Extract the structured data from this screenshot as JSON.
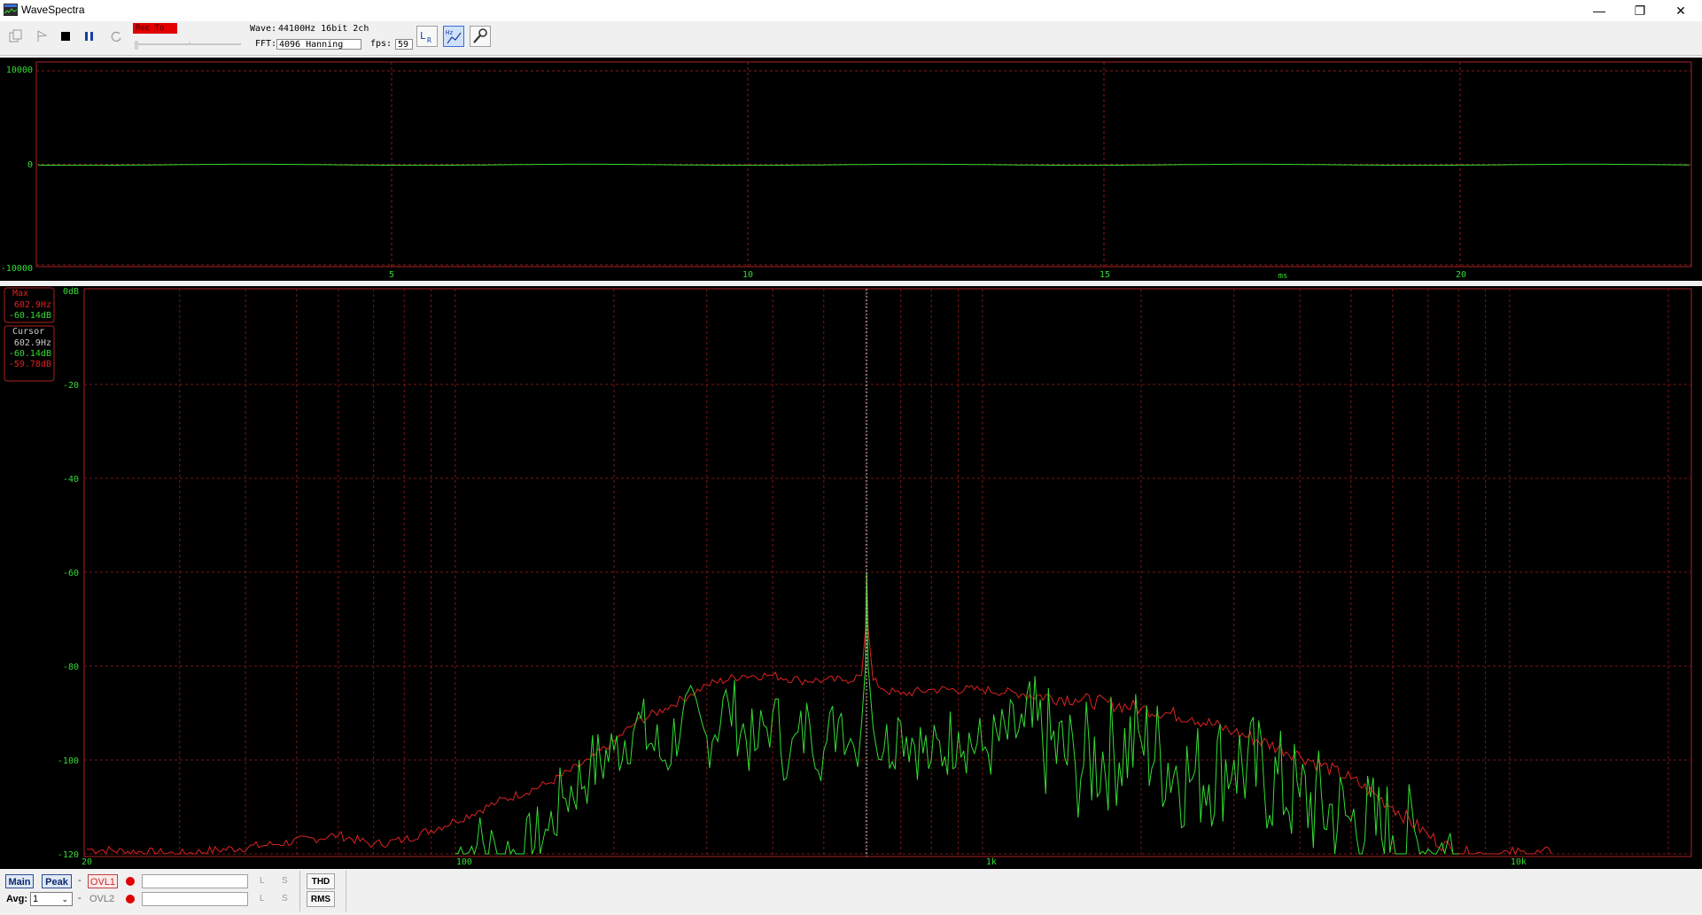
{
  "window": {
    "title": "WaveSpectra",
    "minimize_glyph": "—",
    "restore_glyph": "❐",
    "close_glyph": "✕"
  },
  "toolbar": {
    "rec_label": "Rec To",
    "wave_label": "Wave:",
    "wave_value": "44100Hz 16bit 2ch",
    "fft_label": "FFT:",
    "fft_value": "4096 Hanning",
    "fps_label": "fps:",
    "fps_value": "59",
    "icons": [
      "copy-icon",
      "play-icon",
      "stop-icon",
      "pause-icon",
      "refresh-icon",
      "lr-channel-icon",
      "hz-scale-icon",
      "settings-wrench-icon"
    ]
  },
  "wave_panel": {
    "y_ticks": [
      "10000",
      "0",
      "-10000"
    ],
    "x_ticks": [
      "5",
      "10",
      "15",
      "20"
    ],
    "x_unit": "ms"
  },
  "spectrum_panel": {
    "y_ticks": [
      "0dB",
      "-20",
      "-40",
      "-60",
      "-80",
      "-100",
      "-120"
    ],
    "x_ticks": [
      "20",
      "100",
      "1k",
      "10k"
    ],
    "max_box": {
      "title": "Max",
      "freq": "602.9Hz",
      "level_l": "-60.14dB"
    },
    "cursor_box": {
      "title": "Cursor",
      "freq": "602.9Hz",
      "level_l": "-60.14dB",
      "level_r": "-59.78dB"
    },
    "colors": {
      "left_channel": "#33dd33",
      "right_channel": "#dd2222",
      "grid": "#aa2222",
      "axis_text": "#33dd33",
      "cursor": "#cccccc"
    }
  },
  "chart_data": {
    "type": "line",
    "x_scale": "log",
    "xlim": [
      20,
      22050
    ],
    "ylim": [
      -120,
      0
    ],
    "series": [
      {
        "color": "#dd2222",
        "x": [
          20,
          30,
          45,
          60,
          70,
          80,
          100,
          120,
          150,
          180,
          200,
          220,
          250,
          280,
          300,
          350,
          400,
          450,
          500,
          550,
          590,
          600,
          603,
          607,
          620,
          650,
          700,
          800,
          1000,
          1200,
          1500,
          2000,
          2500,
          3000,
          4000,
          5000,
          6000,
          7000,
          8000,
          9000,
          10000,
          12000
        ],
        "values": [
          -119,
          -120,
          -118,
          -116,
          -118,
          -117,
          -113,
          -109,
          -105,
          -100,
          -96,
          -92,
          -89,
          -86,
          -84,
          -82,
          -82,
          -83,
          -83,
          -83,
          -82,
          -72,
          -60,
          -72,
          -83,
          -85,
          -86,
          -85,
          -85,
          -86,
          -87,
          -89,
          -91,
          -94,
          -99,
          -104,
          -110,
          -116,
          -120,
          -120,
          -120,
          -120
        ]
      },
      {
        "color": "#33dd33",
        "x": [
          100,
          110,
          120,
          135,
          150,
          160,
          180,
          200,
          220,
          250,
          270,
          300,
          330,
          370,
          400,
          430,
          470,
          500,
          540,
          570,
          590,
          600,
          603,
          607,
          620,
          650,
          700,
          800,
          900,
          1000,
          1200,
          1500,
          2000,
          2500,
          3000,
          4000,
          5000,
          6000,
          7000,
          8000
        ],
        "values": [
          -120,
          -118,
          -120,
          -120,
          -115,
          -108,
          -102,
          -98,
          -92,
          -100,
          -90,
          -95,
          -88,
          -98,
          -90,
          -100,
          -92,
          -98,
          -90,
          -97,
          -92,
          -80,
          -60,
          -80,
          -93,
          -98,
          -92,
          -100,
          -94,
          -98,
          -93,
          -101,
          -96,
          -104,
          -100,
          -108,
          -113,
          -116,
          -119,
          -120
        ]
      }
    ],
    "cursor_freq": 602.9,
    "peak_db": -60.14
  },
  "statusbar": {
    "main_label": "Main",
    "peak_label": "Peak",
    "dash": "-",
    "ovl1_label": "OVL1",
    "ovl2_label": "OVL2",
    "avg_label": "Avg:",
    "avg_value": "1",
    "l_label": "L",
    "s_label": "S",
    "thd_label": "THD",
    "rms_label": "RMS"
  }
}
